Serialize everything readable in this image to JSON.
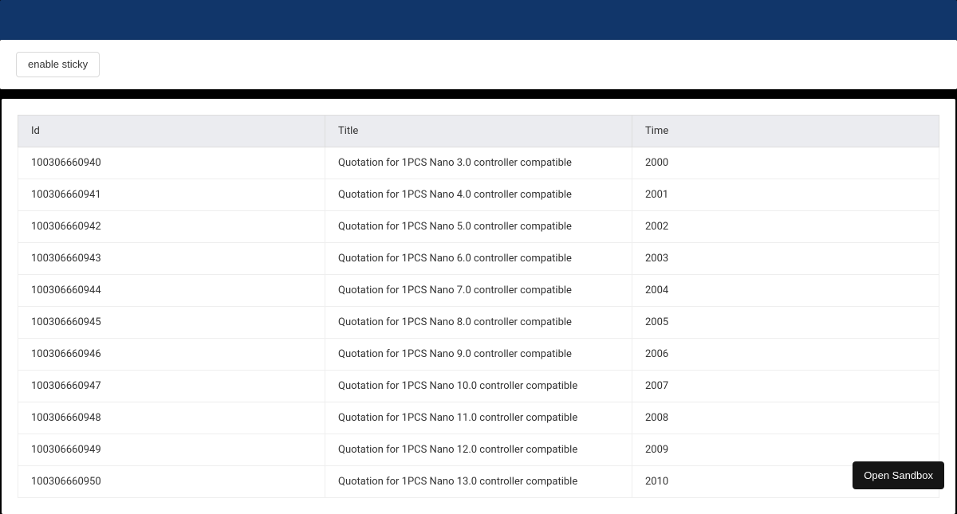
{
  "controls": {
    "toggle_sticky_label": "enable sticky"
  },
  "sandbox": {
    "open_label": "Open Sandbox"
  },
  "table": {
    "headers": {
      "id": "Id",
      "title": "Title",
      "time": "Time"
    },
    "rows": [
      {
        "id": "100306660940",
        "title": "Quotation for 1PCS Nano 3.0 controller compatible",
        "time": "2000"
      },
      {
        "id": "100306660941",
        "title": "Quotation for 1PCS Nano 4.0 controller compatible",
        "time": "2001"
      },
      {
        "id": "100306660942",
        "title": "Quotation for 1PCS Nano 5.0 controller compatible",
        "time": "2002"
      },
      {
        "id": "100306660943",
        "title": "Quotation for 1PCS Nano 6.0 controller compatible",
        "time": "2003"
      },
      {
        "id": "100306660944",
        "title": "Quotation for 1PCS Nano 7.0 controller compatible",
        "time": "2004"
      },
      {
        "id": "100306660945",
        "title": "Quotation for 1PCS Nano 8.0 controller compatible",
        "time": "2005"
      },
      {
        "id": "100306660946",
        "title": "Quotation for 1PCS Nano 9.0 controller compatible",
        "time": "2006"
      },
      {
        "id": "100306660947",
        "title": "Quotation for 1PCS Nano 10.0 controller compatible",
        "time": "2007"
      },
      {
        "id": "100306660948",
        "title": "Quotation for 1PCS Nano 11.0 controller compatible",
        "time": "2008"
      },
      {
        "id": "100306660949",
        "title": "Quotation for 1PCS Nano 12.0 controller compatible",
        "time": "2009"
      },
      {
        "id": "100306660950",
        "title": "Quotation for 1PCS Nano 13.0 controller compatible",
        "time": "2010"
      }
    ]
  }
}
